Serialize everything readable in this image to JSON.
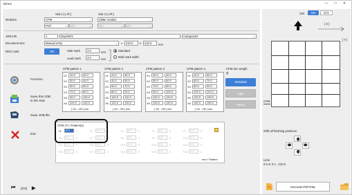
{
  "window": {
    "title": "Direct",
    "minimize": "—",
    "maximize": "□",
    "close": "✕"
  },
  "header": {
    "slot2_label": "Slot 2 [ L/R ]",
    "slot3_label": "Slot 3 [ L/R ]",
    "modules_label": "Modules",
    "slot2_value": "CPM",
    "slot2_sub_value": "Perf.",
    "slot2_sub_na": "N/A",
    "slot3_value": "Slitter module",
    "slot3_na_1": "N/A",
    "slot3_na_2": "N/A",
    "job_info_label": "JOB info",
    "job_number": "1",
    "job_name": "Duplo001",
    "category_value": "Category01",
    "doc_size_label": "Document size",
    "doc_size_value": "Manual entry",
    "doc_width": "210.0",
    "doc_x": "x",
    "doc_height": "210.0",
    "doc_unit": "mm",
    "reg_mark_label": "REG mark",
    "reg_toggle": "ON",
    "side_mark_label": "Side mark",
    "side_mark_value": "3.0",
    "side_mark_unit": "mm",
    "lead_mark_label": "Lead mark",
    "lead_mark_value": "3.0",
    "lead_mark_unit": "mm",
    "opt_standard": "Standard",
    "opt_bold": "Bold mark width"
  },
  "sidebar": {
    "function": "Function",
    "save_job_line1": "Save this JOB",
    "save_job_line2": "in DC-618",
    "save_job_file": "Save JOB file",
    "exit": "Exit",
    "pager": "[2/2]"
  },
  "cpm": {
    "patterns": [
      {
        "title": "CPM pattern 1",
        "rows": [
          [
            "X1",
            "10.0",
            "30.0"
          ],
          [
            "X2",
            "30.0",
            "40.0"
          ],
          [
            "X3",
            "50.0",
            "60.0"
          ],
          [
            "X4",
            "70.0",
            "80.0"
          ],
          [
            "X5",
            "90.0",
            "100.0"
          ],
          [
            "X6",
            "110.0",
            "130.0"
          ]
        ],
        "footer": "[ On - Off ] mm"
      },
      {
        "title": "CPM pattern 2",
        "rows": [
          [
            "X1",
            "20.0",
            "30.0"
          ],
          [
            "X2",
            "40.0",
            "50.0"
          ],
          [
            "X3",
            "60.0",
            "70.0"
          ],
          [
            "X4",
            "80.0",
            "90.0"
          ],
          [
            "X5",
            "100.0",
            "110.0"
          ],
          [
            "X6",
            "120.0",
            "130.0"
          ]
        ],
        "footer": "[ On - Off ] mm"
      },
      {
        "title": "CPM pattern 3",
        "rows": [
          [
            "X1",
            "30.0",
            "40.0"
          ],
          [
            "X2",
            "50.0",
            "60.0"
          ],
          [
            "X3",
            "70.0",
            "80.0"
          ],
          [
            "X4",
            "90.0",
            "100.0"
          ],
          [
            "X5",
            "110.0",
            "120.0"
          ],
          [
            "X6",
            "130.0",
            "140.0"
          ]
        ],
        "footer": "[ On - Off ] mm"
      },
      {
        "title": "CPM pattern 4",
        "rows": [
          [
            "X1",
            "40.0",
            "50.0"
          ],
          [
            "X2",
            "60.0",
            "70.0"
          ],
          [
            "X3",
            "80.0",
            "90.0"
          ],
          [
            "X4",
            "100.0",
            "110.0"
          ],
          [
            "X5",
            "120.0",
            "130.0"
          ],
          [
            "X6",
            "140.0",
            "150.0"
          ]
        ],
        "footer": "[ On - Off ] mm"
      }
    ],
    "doc_weight_label": "CPM doc weight",
    "weight_standard": "Standard",
    "weight_light": "Light",
    "weight_heavy": "Heavy",
    "y_box": {
      "title": "CPM (Y) / Pattern(s)",
      "labels": [
        "Y1",
        "Y2",
        "Y3",
        "Y4",
        "Y5",
        "Y6",
        "Y7",
        "Y8",
        "Y9",
        "Y10",
        "Y11",
        "Y12",
        "Y13",
        "Y14",
        "Y15",
        "Y16",
        "Y17",
        "Y18",
        "Y19",
        "Y20"
      ],
      "value": "0.0",
      "pattern_value": "0",
      "unit": "mm / Pattern"
    }
  },
  "right": {
    "unit_label": "Unit",
    "unit_mm": "mm",
    "unit_inch": "inch",
    "x_label": "[ X ]",
    "y_label": "[ Y ]",
    "cpm_label": "CPM",
    "shift_label": "Shift all finishing positions",
    "limit_label": "Limit",
    "limit_value": "0.0 or 0.1 - 310.0",
    "generate_label": "Generate PDF/XML"
  },
  "colors": {
    "accent": "#3d7fd6",
    "callout": "#111111"
  }
}
